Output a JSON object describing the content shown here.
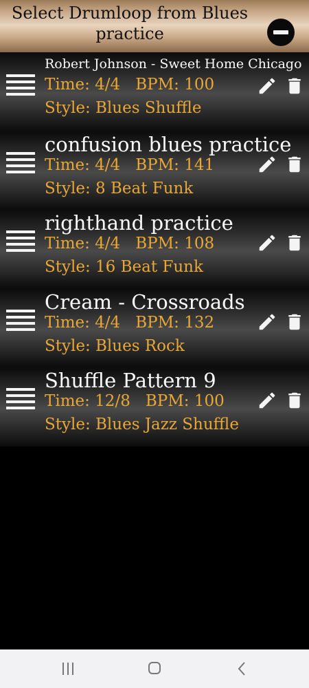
{
  "header": {
    "title": "Select Drumloop from Blues practice"
  },
  "rows": [
    {
      "title": "Robert Johnson - Sweet Home Chicago",
      "time": "Time: 4/4",
      "bpm": "BPM: 100",
      "style": "Style: Blues Shuffle"
    },
    {
      "title": "confusion blues practice",
      "time": "Time: 4/4",
      "bpm": "BPM: 141",
      "style": "Style: 8 Beat Funk"
    },
    {
      "title": "righthand practice",
      "time": "Time: 4/4",
      "bpm": "BPM: 108",
      "style": "Style: 16 Beat Funk"
    },
    {
      "title": "Cream - Crossroads",
      "time": "Time: 4/4",
      "bpm": "BPM: 132",
      "style": "Style: Blues Rock"
    },
    {
      "title": "Shuffle Pattern 9",
      "time": "Time: 12/8",
      "bpm": "BPM: 100",
      "style": "Style: Blues Jazz Shuffle"
    }
  ],
  "icons": {
    "drag": "drag-handle-icon",
    "edit": "pencil-icon",
    "delete": "trash-icon",
    "collapse": "minus-circle-icon"
  },
  "colors": {
    "accent": "#e9a736",
    "title": "#fafafa",
    "background": "#000000"
  }
}
